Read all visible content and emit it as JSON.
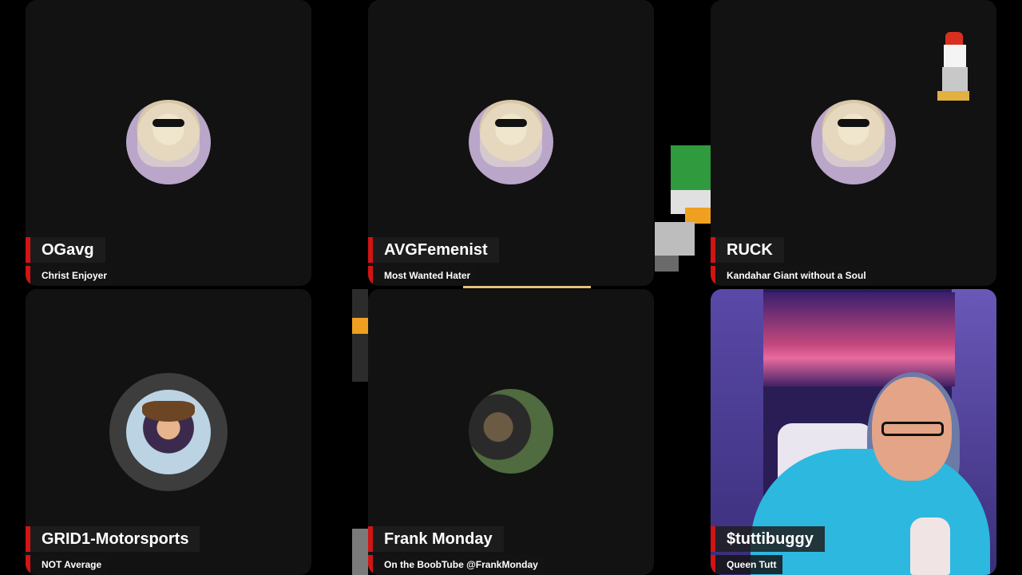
{
  "participants": [
    {
      "name": "OGavg",
      "subtitle": "Christ Enjoyer",
      "avatar_icon": "avatar-blonde-sunglasses"
    },
    {
      "name": "AVGFemenist",
      "subtitle": "Most Wanted Hater",
      "avatar_icon": "avatar-blonde-sunglasses"
    },
    {
      "name": "RUCK",
      "subtitle": "Kandahar Giant without a Soul",
      "avatar_icon": "avatar-blonde-sunglasses"
    },
    {
      "name": "GRID1-Motorsports",
      "subtitle": "NOT Average",
      "avatar_icon": "avatar-cowboy"
    },
    {
      "name": "Frank Monday",
      "subtitle": "On the BoobTube @FrankMonday",
      "avatar_icon": "avatar-two-people"
    },
    {
      "name": "$tuttibuggy",
      "subtitle": "Queen Tutt",
      "avatar_icon": "live-video"
    }
  ],
  "colors": {
    "background": "#000000",
    "tile": "#121212",
    "accent": "#d21414"
  }
}
